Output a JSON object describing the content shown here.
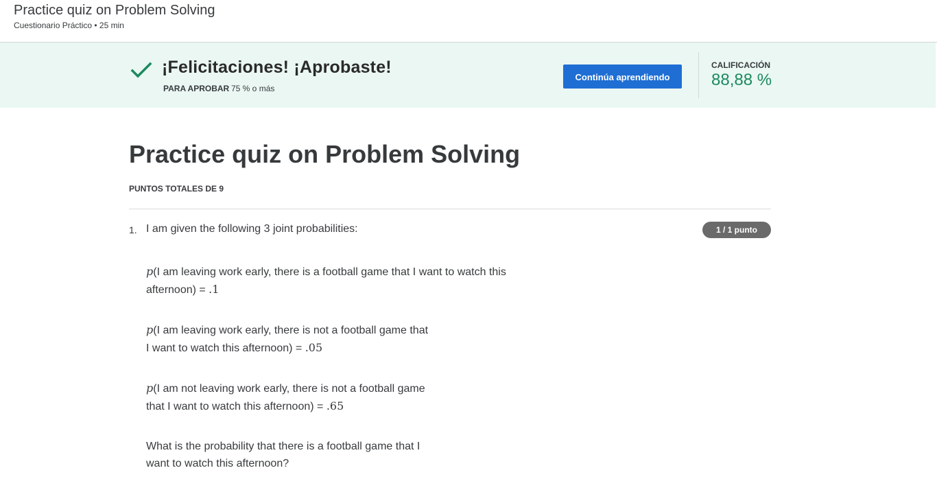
{
  "header": {
    "title": "Practice quiz on Problem Solving",
    "subtitle": "Cuestionario Práctico • 25 min"
  },
  "banner": {
    "headline": "¡Felicitaciones! ¡Aprobaste!",
    "pass_label": "PARA APROBAR",
    "pass_value": "75 % o más",
    "continue_label": "Continúa aprendiendo",
    "grade_label": "CALIFICACIÓN",
    "grade_value": "88,88 %",
    "colors": {
      "banner_bg": "#eaf7f3",
      "check": "#1b8a5f",
      "button": "#1f6ed4",
      "grade": "#1b8a5f"
    },
    "icon": "check-icon"
  },
  "main": {
    "title": "Practice quiz on Problem Solving",
    "total_points": "PUNTOS TOTALES DE 9"
  },
  "question": {
    "number": "1.",
    "text": "I am given the following 3 joint probabilities:",
    "score": "1 / 1 punto",
    "items": [
      {
        "var": "p",
        "line1": "(I am leaving work early, there is a football game that I want to watch this",
        "line2_text": "afternoon) = ",
        "value": ".1"
      },
      {
        "var": "p",
        "line1": "(I am leaving work early, there is not a football game that",
        "line2_text": "I want to watch this afternoon) = ",
        "value": ".05"
      },
      {
        "var": "p",
        "line1": "(I am not leaving work early, there is not a football game",
        "line2_text": "that I want to watch this afternoon) = ",
        "value": ".65"
      }
    ],
    "prompt_line1": "What is the probability that there is a football game that I",
    "prompt_line2": "want to watch this afternoon?"
  }
}
